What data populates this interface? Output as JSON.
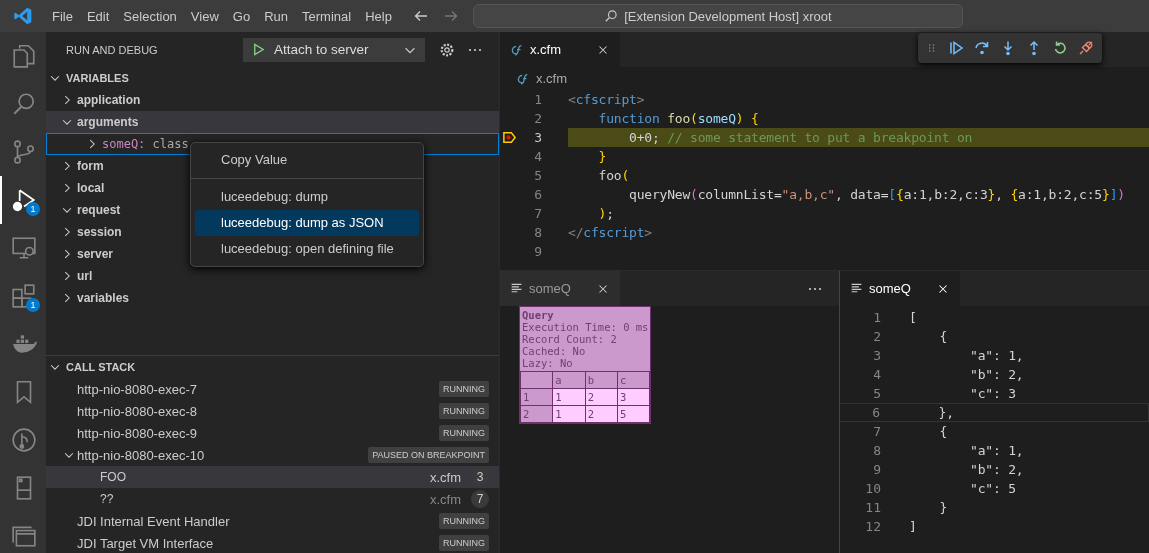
{
  "title_bar": {
    "menu": [
      "File",
      "Edit",
      "Selection",
      "View",
      "Go",
      "Run",
      "Terminal",
      "Help"
    ],
    "command_center": "[Extension Development Host] xroot"
  },
  "activity_bar": [
    {
      "kind": "files",
      "selected": false
    },
    {
      "kind": "search",
      "selected": false
    },
    {
      "kind": "source-control",
      "selected": false
    },
    {
      "kind": "debug",
      "selected": true,
      "badge": "1"
    },
    {
      "kind": "remote",
      "selected": false
    },
    {
      "kind": "extensions",
      "selected": false,
      "badge": "1"
    },
    {
      "kind": "docker",
      "selected": false
    },
    {
      "kind": "bookmark",
      "selected": false
    },
    {
      "kind": "git-graph",
      "selected": false
    },
    {
      "kind": "device",
      "selected": false
    },
    {
      "kind": "windows",
      "selected": false
    }
  ],
  "sidebar": {
    "title": "RUN AND DEBUG",
    "launch_config": "Attach to server",
    "variables": {
      "title": "VARIABLES",
      "expanded": true,
      "items": [
        {
          "name": "application",
          "expanded": false,
          "selected": false
        },
        {
          "name": "arguments",
          "expanded": true,
          "selected": true,
          "children": [
            {
              "name": "someQ:",
              "value": "class",
              "expanded": false,
              "focused": true
            }
          ]
        },
        {
          "name": "form",
          "expanded": false,
          "selected": false
        },
        {
          "name": "local",
          "expanded": false,
          "selected": false
        },
        {
          "name": "request",
          "expanded": true,
          "selected": false
        },
        {
          "name": "session",
          "expanded": false,
          "selected": false
        },
        {
          "name": "server",
          "expanded": false,
          "selected": false
        },
        {
          "name": "url",
          "expanded": false,
          "selected": false
        },
        {
          "name": "variables",
          "expanded": false,
          "selected": false
        }
      ]
    },
    "call_stack": {
      "title": "CALL STACK",
      "expanded": true,
      "threads": [
        {
          "name": "http-nio-8080-exec-7",
          "status": "RUNNING",
          "expanded": false
        },
        {
          "name": "http-nio-8080-exec-8",
          "status": "RUNNING",
          "expanded": false
        },
        {
          "name": "http-nio-8080-exec-9",
          "status": "RUNNING",
          "expanded": false
        },
        {
          "name": "http-nio-8080-exec-10",
          "status": "PAUSED ON BREAKPOINT",
          "expanded": true,
          "frames": [
            {
              "name": "FOO",
              "file": "x.cfm",
              "line": "3",
              "selected": true
            },
            {
              "name": "??",
              "file": "x.cfm",
              "line": "7",
              "selected": false
            }
          ]
        },
        {
          "name": "JDI Internal Event Handler",
          "status": "RUNNING",
          "expanded": false
        },
        {
          "name": "JDI Target VM Interface",
          "status": "RUNNING",
          "expanded": false
        }
      ]
    }
  },
  "context_menu": {
    "groups": [
      [
        {
          "label": "Copy Value",
          "selected": false
        }
      ],
      [
        {
          "label": "luceedebug: dump",
          "selected": false
        },
        {
          "label": "luceedebug: dump as JSON",
          "selected": true
        },
        {
          "label": "luceedebug: open defining file",
          "selected": false
        }
      ]
    ]
  },
  "editor": {
    "tabs": [
      {
        "label": "x.cfm",
        "selected": true
      }
    ],
    "breadcrumb": "x.cfm",
    "lines": [
      {
        "number": "1",
        "current": false,
        "breakpoint": false,
        "tokens": [
          {
            "text": "<",
            "kind": "tag-punct"
          },
          {
            "text": "cfscript",
            "kind": "tag"
          },
          {
            "text": ">",
            "kind": "tag-punct"
          }
        ]
      },
      {
        "number": "2",
        "current": false,
        "breakpoint": false,
        "tokens": [
          {
            "text": "    function",
            "kind": "keyword"
          },
          {
            "text": " foo",
            "kind": "function"
          },
          {
            "text": "(",
            "kind": "bracket1"
          },
          {
            "text": "someQ",
            "kind": "variable"
          },
          {
            "text": ")",
            "kind": "bracket1"
          },
          {
            "text": " {",
            "kind": "bracket1"
          }
        ]
      },
      {
        "number": "3",
        "current": true,
        "breakpoint": true,
        "tokens": [
          {
            "text": "        0+0; ",
            "kind": "plain"
          },
          {
            "text": "// some statement to put a breakpoint on",
            "kind": "comment"
          }
        ]
      },
      {
        "number": "4",
        "current": false,
        "breakpoint": false,
        "tokens": [
          {
            "text": "    }",
            "kind": "bracket1"
          }
        ]
      },
      {
        "number": "5",
        "current": false,
        "breakpoint": false,
        "tokens": [
          {
            "text": "    foo",
            "kind": "plain"
          },
          {
            "text": "(",
            "kind": "bracket1"
          }
        ]
      },
      {
        "number": "6",
        "current": false,
        "breakpoint": false,
        "tokens": [
          {
            "text": "        queryNew",
            "kind": "plain"
          },
          {
            "text": "(",
            "kind": "bracket2"
          },
          {
            "text": "columnList=",
            "kind": "plain"
          },
          {
            "text": "\"a,b,c\"",
            "kind": "string"
          },
          {
            "text": ", data=",
            "kind": "plain"
          },
          {
            "text": "[",
            "kind": "bracket3"
          },
          {
            "text": "{",
            "kind": "bracket1"
          },
          {
            "text": "a:1,b:2,c:3",
            "kind": "plain"
          },
          {
            "text": "}",
            "kind": "bracket1"
          },
          {
            "text": ", ",
            "kind": "plain"
          },
          {
            "text": "{",
            "kind": "bracket1"
          },
          {
            "text": "a:1,b:2,c:5",
            "kind": "plain"
          },
          {
            "text": "}",
            "kind": "bracket1"
          },
          {
            "text": "]",
            "kind": "bracket3"
          },
          {
            "text": ")",
            "kind": "bracket2"
          }
        ]
      },
      {
        "number": "7",
        "current": false,
        "breakpoint": false,
        "tokens": [
          {
            "text": "    )",
            "kind": "bracket1"
          },
          {
            "text": ";",
            "kind": "plain"
          }
        ]
      },
      {
        "number": "8",
        "current": false,
        "breakpoint": false,
        "tokens": [
          {
            "text": "</",
            "kind": "tag-punct"
          },
          {
            "text": "cfscript",
            "kind": "tag"
          },
          {
            "text": ">",
            "kind": "tag-punct"
          }
        ]
      },
      {
        "number": "9",
        "current": false,
        "breakpoint": false
      }
    ]
  },
  "dump_panel": {
    "tabs": [
      {
        "label": "someQ",
        "selected": false
      }
    ],
    "query": {
      "title": "Query",
      "details": [
        "Execution Time: 0 ms",
        "Record Count: 2",
        "Cached: No",
        "Lazy: No"
      ],
      "columns": [
        "a",
        "b",
        "c"
      ],
      "rows": [
        {
          "index": "1",
          "cells": [
            "1",
            "2",
            "3"
          ]
        },
        {
          "index": "2",
          "cells": [
            "1",
            "2",
            "5"
          ]
        }
      ]
    }
  },
  "json_panel": {
    "tabs": [
      {
        "label": "someQ",
        "selected": true
      }
    ],
    "lines": [
      {
        "number": "1",
        "text": "[",
        "current": false
      },
      {
        "number": "2",
        "text": "    {",
        "current": false
      },
      {
        "number": "3",
        "text": "        \"a\": 1,",
        "current": false
      },
      {
        "number": "4",
        "text": "        \"b\": 2,",
        "current": false
      },
      {
        "number": "5",
        "text": "        \"c\": 3",
        "current": false
      },
      {
        "number": "6",
        "text": "    },",
        "current": true
      },
      {
        "number": "7",
        "text": "    {",
        "current": false
      },
      {
        "number": "8",
        "text": "        \"a\": 1,",
        "current": false
      },
      {
        "number": "9",
        "text": "        \"b\": 2,",
        "current": false
      },
      {
        "number": "10",
        "text": "        \"c\": 5",
        "current": false
      },
      {
        "number": "11",
        "text": "    }",
        "current": false
      },
      {
        "number": "12",
        "text": "]",
        "current": false
      }
    ]
  }
}
